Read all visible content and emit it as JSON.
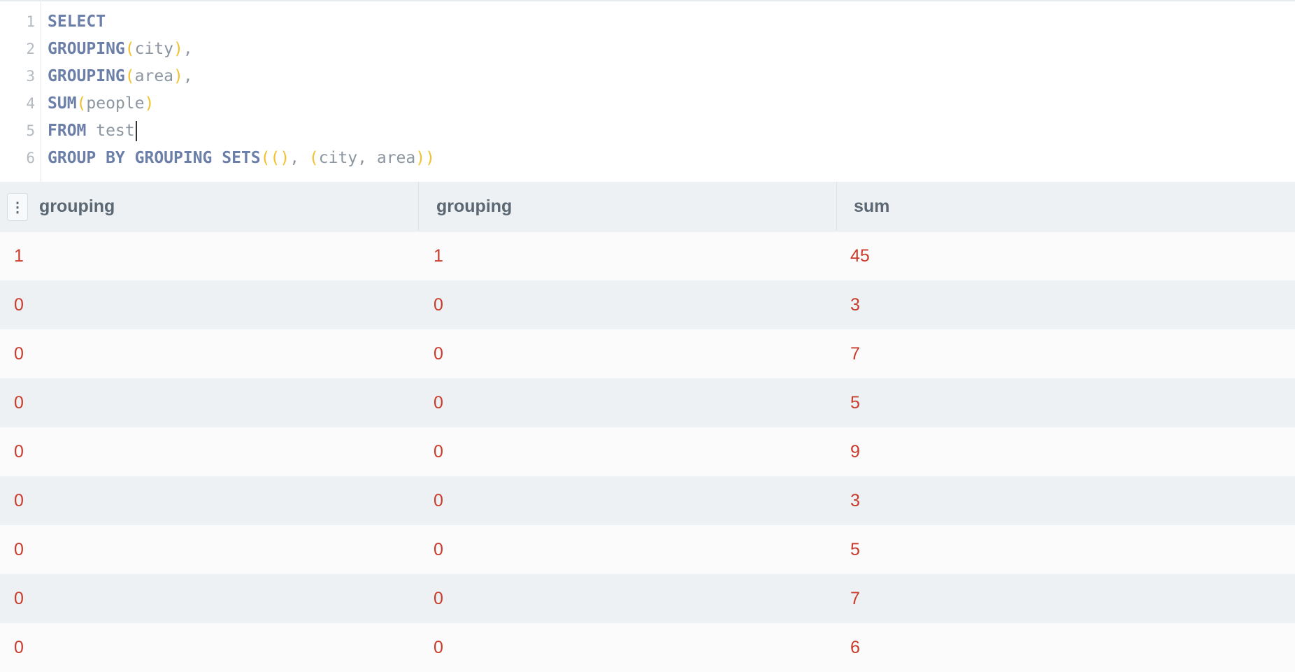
{
  "editor": {
    "lines": [
      {
        "num": "1",
        "tokens": [
          {
            "t": "SELECT",
            "c": "kw"
          }
        ]
      },
      {
        "num": "2",
        "tokens": [
          {
            "t": "GROUPING",
            "c": "kw"
          },
          {
            "t": "(",
            "c": "paren"
          },
          {
            "t": "city",
            "c": "id"
          },
          {
            "t": ")",
            "c": "paren"
          },
          {
            "t": ",",
            "c": "punct"
          }
        ]
      },
      {
        "num": "3",
        "tokens": [
          {
            "t": "GROUPING",
            "c": "kw"
          },
          {
            "t": "(",
            "c": "paren"
          },
          {
            "t": "area",
            "c": "id"
          },
          {
            "t": ")",
            "c": "paren"
          },
          {
            "t": ",",
            "c": "punct"
          }
        ]
      },
      {
        "num": "4",
        "tokens": [
          {
            "t": "SUM",
            "c": "kw"
          },
          {
            "t": "(",
            "c": "paren"
          },
          {
            "t": "people",
            "c": "id"
          },
          {
            "t": ")",
            "c": "paren"
          }
        ]
      },
      {
        "num": "5",
        "tokens": [
          {
            "t": "FROM",
            "c": "kw"
          },
          {
            "t": " test",
            "c": "id"
          }
        ],
        "caret": true
      },
      {
        "num": "6",
        "tokens": [
          {
            "t": "GROUP BY GROUPING SETS",
            "c": "kw"
          },
          {
            "t": "((",
            "c": "paren"
          },
          {
            "t": ")",
            "c": "paren"
          },
          {
            "t": ", ",
            "c": "punct"
          },
          {
            "t": "(",
            "c": "paren"
          },
          {
            "t": "city, area",
            "c": "id"
          },
          {
            "t": "))",
            "c": "paren"
          }
        ]
      }
    ]
  },
  "results": {
    "menu_icon": "kebab-menu-icon",
    "columns": [
      "grouping",
      "grouping",
      "sum"
    ],
    "rows": [
      [
        "1",
        "1",
        "45"
      ],
      [
        "0",
        "0",
        "3"
      ],
      [
        "0",
        "0",
        "7"
      ],
      [
        "0",
        "0",
        "5"
      ],
      [
        "0",
        "0",
        "9"
      ],
      [
        "0",
        "0",
        "3"
      ],
      [
        "0",
        "0",
        "5"
      ],
      [
        "0",
        "0",
        "7"
      ],
      [
        "0",
        "0",
        "6"
      ]
    ]
  },
  "colors": {
    "keyword": "#6c7fa8",
    "paren": "#f2c12e",
    "identifier": "#8c96a0",
    "cell_value": "#c93c2c",
    "header_text": "#5b6773"
  }
}
